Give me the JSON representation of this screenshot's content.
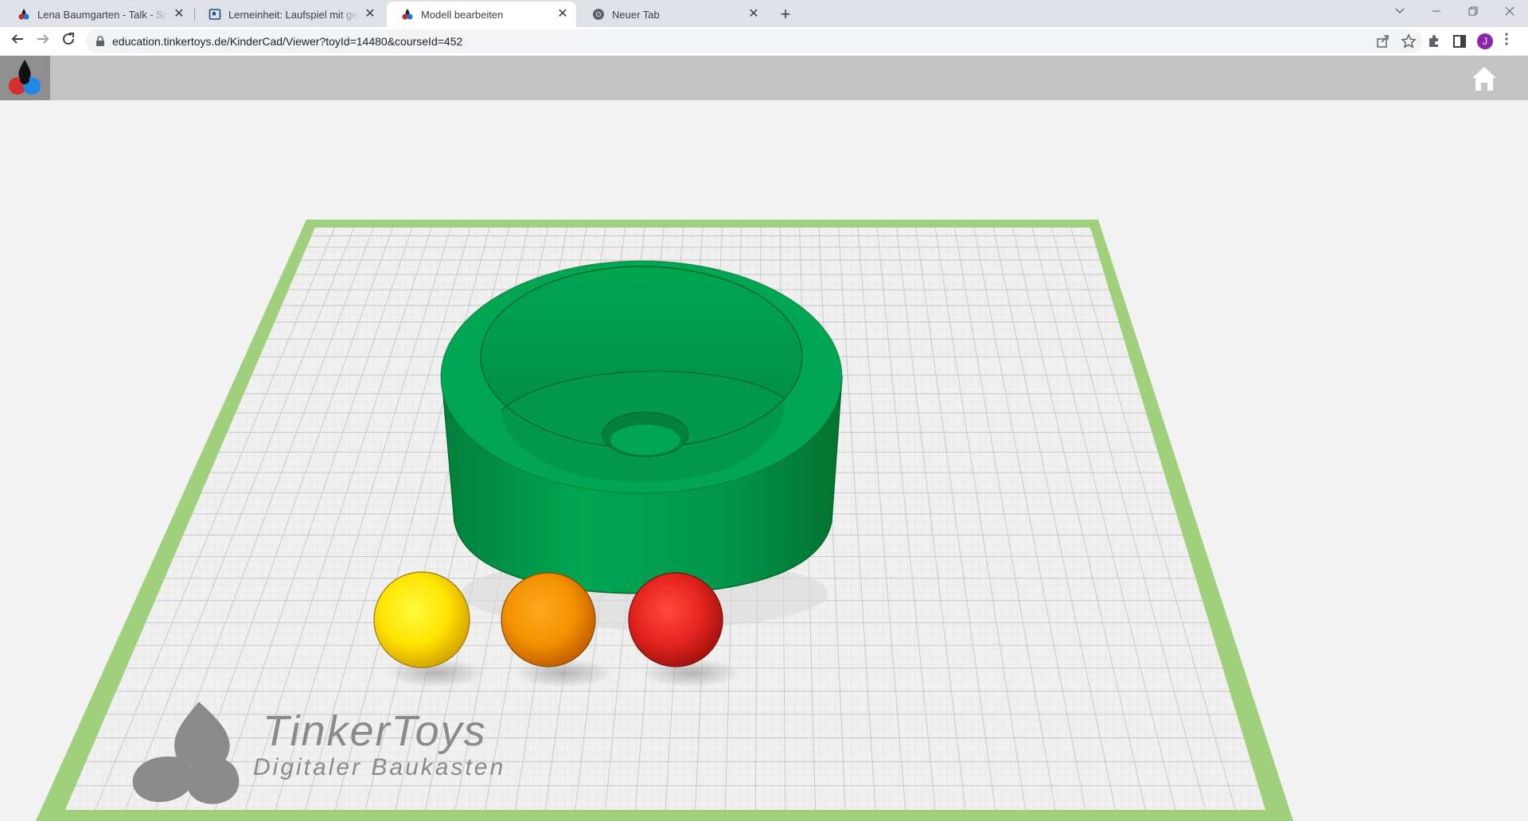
{
  "browser": {
    "tabs": [
      {
        "title": "Lena Baumgarten - Talk - Sprechstunde",
        "favicon": "tinkertoys-logo-icon",
        "active": false
      },
      {
        "title": "Lerneinheit: Laufspiel mit gezinkten Würfeln",
        "favicon": "lesson-icon",
        "active": false
      },
      {
        "title": "Modell bearbeiten",
        "favicon": "tinkertoys-logo-icon",
        "active": true
      },
      {
        "title": "Neuer Tab",
        "favicon": "chrome-icon",
        "active": false
      }
    ],
    "close_glyph": "✕",
    "new_tab_glyph": "+",
    "url": "education.tinkertoys.de/KinderCad/Viewer?toyId=14480&courseId=452",
    "profile_initial": "J"
  },
  "app": {
    "logo": "tinkertoys-logo-icon",
    "home_icon": "home-icon"
  },
  "scene": {
    "objects": [
      {
        "name": "green-cylinder-bowl",
        "color": "#00a651"
      },
      {
        "name": "yellow-ball",
        "color": "#ffe400"
      },
      {
        "name": "orange-ball",
        "color": "#f39200"
      },
      {
        "name": "red-ball",
        "color": "#e52420"
      }
    ],
    "grid_border_color": "#a0d07c"
  },
  "watermark": {
    "brand": "TinkerToys",
    "tagline": "Digitaler Baukasten"
  }
}
